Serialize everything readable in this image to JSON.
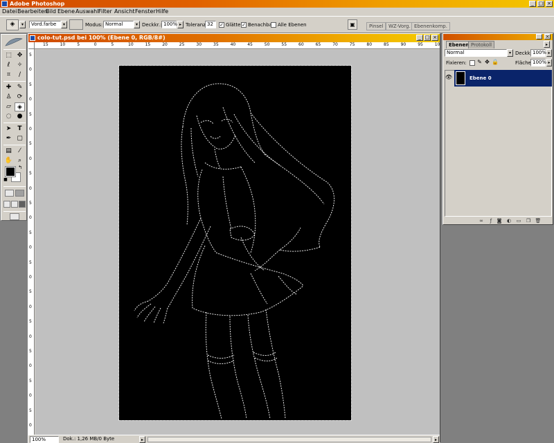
{
  "app": {
    "title": "Adobe Photoshop"
  },
  "window_controls": {
    "minimize": "_",
    "maximize": "□",
    "close": "×"
  },
  "menu": [
    "Datei",
    "Bearbeiten",
    "Bild",
    "Ebene",
    "Auswahl",
    "Filter",
    "Ansicht",
    "Fenster",
    "Hilfe"
  ],
  "options": {
    "fill_source": "Vord.farbe",
    "mode_label": "Modus:",
    "mode_value": "Normal",
    "opacity_label": "Deckkr.:",
    "opacity_value": "100%",
    "tolerance_label": "Toleranz:",
    "tolerance_value": "32",
    "antialias_label": "Glätten",
    "antialias_checked": true,
    "contiguous_label": "Benachbart",
    "contiguous_checked": true,
    "all_layers_label": "Alle Ebenen",
    "all_layers_checked": false,
    "well_tabs": [
      "Pinsel",
      "WZ-Vorg.",
      "Ebenenkomp."
    ]
  },
  "document": {
    "title": "colo-tut.psd bei 100% (Ebene 0, RGB/8#)",
    "zoom": "100%",
    "doc_info": "Dok.: 1,26 MB/0 Byte",
    "h_ruler": [
      "15",
      "10",
      "5",
      "0",
      "5",
      "10",
      "15",
      "20",
      "25",
      "30",
      "35",
      "40",
      "45",
      "50",
      "55",
      "60",
      "65",
      "70",
      "75",
      "80",
      "85",
      "90",
      "95",
      "10"
    ],
    "v_ruler": [
      "5",
      "0",
      "5",
      "0",
      "5",
      "0",
      "5",
      "0",
      "5",
      "0",
      "5",
      "0",
      "5",
      "0",
      "5",
      "0",
      "5",
      "0",
      "5",
      "0",
      "5",
      "0",
      "5",
      "0",
      "5",
      "0"
    ]
  },
  "layers_panel": {
    "tabs": [
      "Ebenen",
      "Protokoll"
    ],
    "blend_mode": "Normal",
    "opacity_label": "Deckkr.:",
    "opacity_value": "100%",
    "lock_label": "Fixieren:",
    "fill_label": "Fläche:",
    "fill_value": "100%",
    "layers": [
      {
        "name": "Ebene 0",
        "visible": true,
        "selected": true
      }
    ]
  },
  "colors": {
    "foreground": "#000000",
    "background": "#ffffff",
    "selection": "#0a246a",
    "canvas": "#000000"
  }
}
